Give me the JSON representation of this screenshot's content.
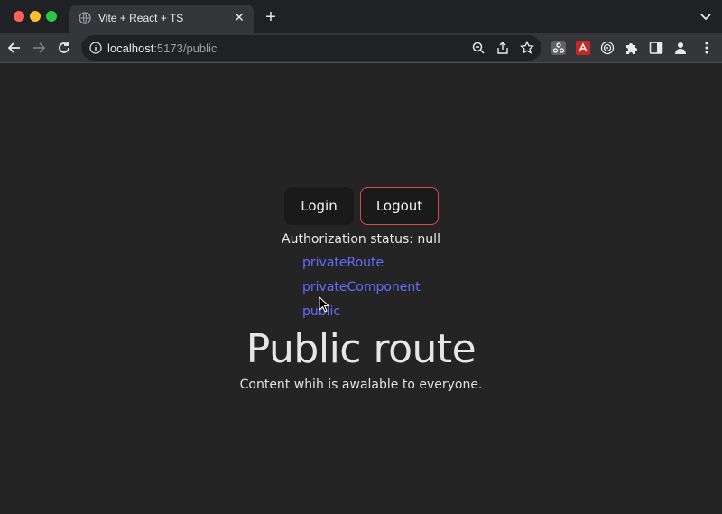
{
  "browser": {
    "tab_title": "Vite + React + TS",
    "new_tab_symbol": "+",
    "close_symbol": "✕",
    "url_host": "localhost",
    "url_path": ":5173/public"
  },
  "page": {
    "login_label": "Login",
    "logout_label": "Logout",
    "status_text": "Authorization status: null",
    "links": [
      "privateRoute",
      "privateComponent",
      "public"
    ],
    "heading": "Public route",
    "description": "Content whih is awalable to everyone."
  },
  "colors": {
    "link": "#646cff",
    "logout_border": "#e0474c",
    "page_bg": "#242424"
  }
}
